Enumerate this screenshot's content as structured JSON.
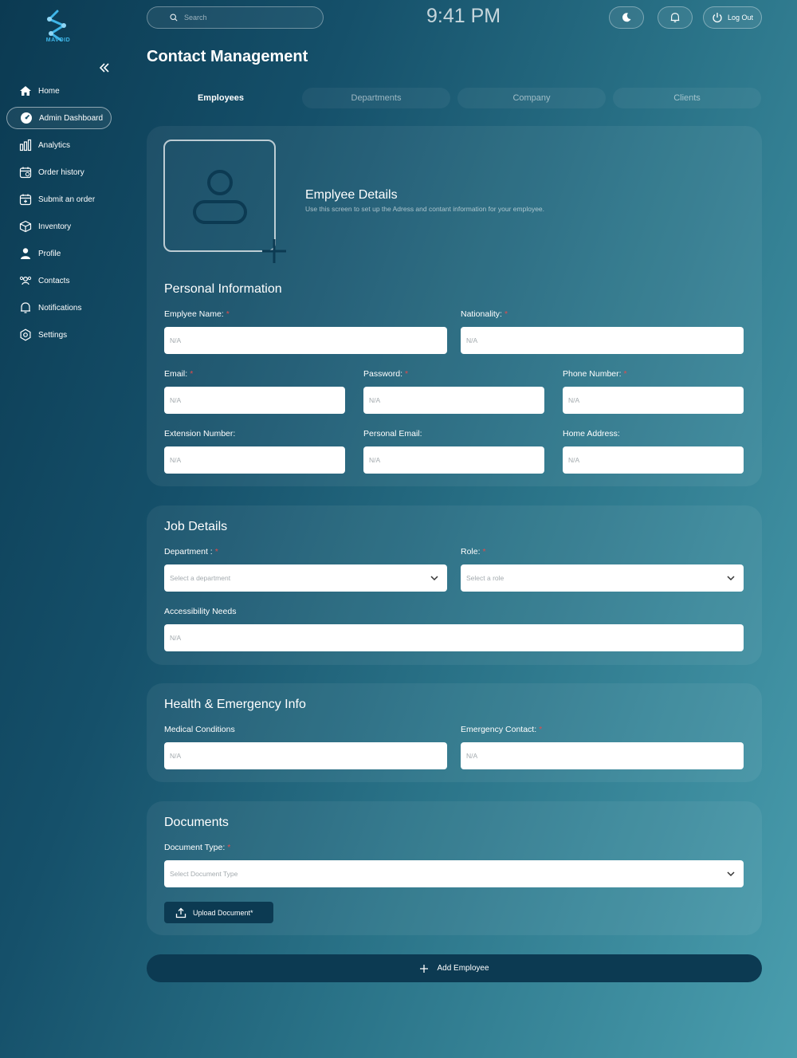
{
  "brand": {
    "name": "MAVOID"
  },
  "sidebar": {
    "items": [
      {
        "label": "Home",
        "icon": "home-icon"
      },
      {
        "label": "Admin Dashboard",
        "icon": "dashboard-icon",
        "active": true
      },
      {
        "label": "Analytics",
        "icon": "analytics-icon"
      },
      {
        "label": "Order history",
        "icon": "calendar-icon"
      },
      {
        "label": "Submit an order",
        "icon": "calendar-add-icon"
      },
      {
        "label": "Inventory",
        "icon": "box-icon"
      },
      {
        "label": "Profile",
        "icon": "person-icon"
      },
      {
        "label": "Contacts",
        "icon": "contacts-icon"
      },
      {
        "label": "Notifications",
        "icon": "bell-icon"
      },
      {
        "label": "Settings",
        "icon": "gear-icon"
      }
    ]
  },
  "topbar": {
    "search_placeholder": "Search",
    "time": "9:41 PM",
    "logout_label": "Log Out"
  },
  "page": {
    "title": "Contact Management"
  },
  "tabs": [
    {
      "label": "Employees",
      "active": true
    },
    {
      "label": "Departments"
    },
    {
      "label": "Company"
    },
    {
      "label": "Clients"
    }
  ],
  "header": {
    "title": "Emplyee Details",
    "subtitle": "Use this screen to set up the Adress and contant information for your employee."
  },
  "personal": {
    "title": "Personal Information",
    "name_label": "Emplyee  Name:",
    "nationality_label": "Nationality:",
    "email_label": "Email:",
    "password_label": "Password:",
    "phone_label": "Phone Number:",
    "extension_label": "Extension Number:",
    "personal_email_label": "Personal Email:",
    "home_address_label": "Home Address:",
    "placeholder": "N/A"
  },
  "job": {
    "title": "Job Details",
    "department_label": "Department :",
    "department_placeholder": "Select a department",
    "role_label": "Role:",
    "role_placeholder": "Select a role",
    "accessibility_label": "Accessibility Needs",
    "placeholder": "N/A"
  },
  "health": {
    "title": "Health & Emergency Info",
    "medical_label": "Medical Conditions",
    "emergency_label": "Emergency Contact:",
    "placeholder": "N/A"
  },
  "documents": {
    "title": "Documents",
    "type_label": "Document Type:",
    "type_placeholder": "Select Document Type",
    "upload_label": "Upload Document*"
  },
  "actions": {
    "add_label": "Add Employee"
  },
  "required_mark": "*",
  "colors": {
    "accent": "#3fb6e8",
    "button_dark": "#0c3a52",
    "required": "#e24b4b"
  }
}
